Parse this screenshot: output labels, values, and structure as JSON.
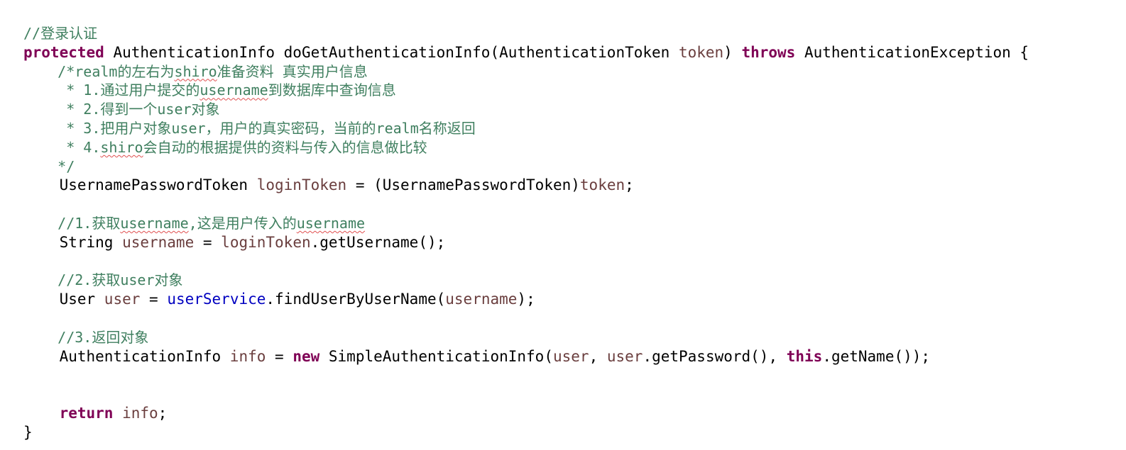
{
  "editor": {
    "lines": [
      [
        {
          "t": "//登录认证",
          "c": "cmt"
        }
      ],
      [
        {
          "t": "protected",
          "c": "kw"
        },
        {
          "t": " AuthenticationInfo doGetAuthenticationInfo(AuthenticationToken "
        },
        {
          "t": "token",
          "c": "var"
        },
        {
          "t": ") "
        },
        {
          "t": "throws",
          "c": "kw"
        },
        {
          "t": " AuthenticationException {"
        }
      ],
      [
        {
          "t": "    /*realm的左右为",
          "c": "cmt"
        },
        {
          "t": "shiro",
          "c": "cmt sq"
        },
        {
          "t": "准备资料 真实用户信息",
          "c": "cmt"
        }
      ],
      [
        {
          "t": "     * 1.通过用户提交的",
          "c": "cmt"
        },
        {
          "t": "username",
          "c": "cmt sq"
        },
        {
          "t": "到数据库中查询信息",
          "c": "cmt"
        }
      ],
      [
        {
          "t": "     * 2.得到一个user对象",
          "c": "cmt"
        }
      ],
      [
        {
          "t": "     * 3.把用户对象user，用户的真实密码，当前的realm名称返回",
          "c": "cmt"
        }
      ],
      [
        {
          "t": "     * 4.",
          "c": "cmt"
        },
        {
          "t": "shiro",
          "c": "cmt sq"
        },
        {
          "t": "会自动的根据提供的资料与传入的信息做比较",
          "c": "cmt"
        }
      ],
      [
        {
          "t": "    */",
          "c": "cmt"
        }
      ],
      [
        {
          "t": "    UsernamePasswordToken "
        },
        {
          "t": "loginToken",
          "c": "var"
        },
        {
          "t": " = (UsernamePasswordToken)"
        },
        {
          "t": "token",
          "c": "var"
        },
        {
          "t": ";"
        }
      ],
      [],
      [
        {
          "t": "    //1.获取",
          "c": "cmt"
        },
        {
          "t": "username",
          "c": "cmt sq"
        },
        {
          "t": ",这是用户传入的",
          "c": "cmt"
        },
        {
          "t": "username",
          "c": "cmt sq"
        }
      ],
      [
        {
          "t": "    String "
        },
        {
          "t": "username",
          "c": "var"
        },
        {
          "t": " = "
        },
        {
          "t": "loginToken",
          "c": "var"
        },
        {
          "t": ".getUsername();"
        }
      ],
      [],
      [
        {
          "t": "    //2.获取user对象",
          "c": "cmt"
        }
      ],
      [
        {
          "t": "    User "
        },
        {
          "t": "user",
          "c": "var"
        },
        {
          "t": " = "
        },
        {
          "t": "userService",
          "c": "fld"
        },
        {
          "t": ".findUserByUserName("
        },
        {
          "t": "username",
          "c": "var"
        },
        {
          "t": ");"
        }
      ],
      [],
      [
        {
          "t": "    //3.返回对象",
          "c": "cmt"
        }
      ],
      [
        {
          "t": "    AuthenticationInfo "
        },
        {
          "t": "info",
          "c": "var"
        },
        {
          "t": " = "
        },
        {
          "t": "new",
          "c": "kw"
        },
        {
          "t": " SimpleAuthenticationInfo("
        },
        {
          "t": "user",
          "c": "var"
        },
        {
          "t": ", "
        },
        {
          "t": "user",
          "c": "var"
        },
        {
          "t": ".getPassword(), "
        },
        {
          "t": "this",
          "c": "kw"
        },
        {
          "t": ".getName());"
        }
      ],
      [],
      [],
      [
        {
          "t": "    "
        },
        {
          "t": "return",
          "c": "kw"
        },
        {
          "t": " "
        },
        {
          "t": "info",
          "c": "var"
        },
        {
          "t": ";"
        }
      ],
      [
        {
          "t": "}"
        }
      ]
    ]
  },
  "colors": {
    "comment": "#3f7f5f",
    "keyword": "#7f0055",
    "local_variable": "#6a3e3e",
    "field": "#0000c0",
    "plain": "#000000",
    "background": "#ffffff",
    "spellcheck_underline": "#e05050"
  }
}
